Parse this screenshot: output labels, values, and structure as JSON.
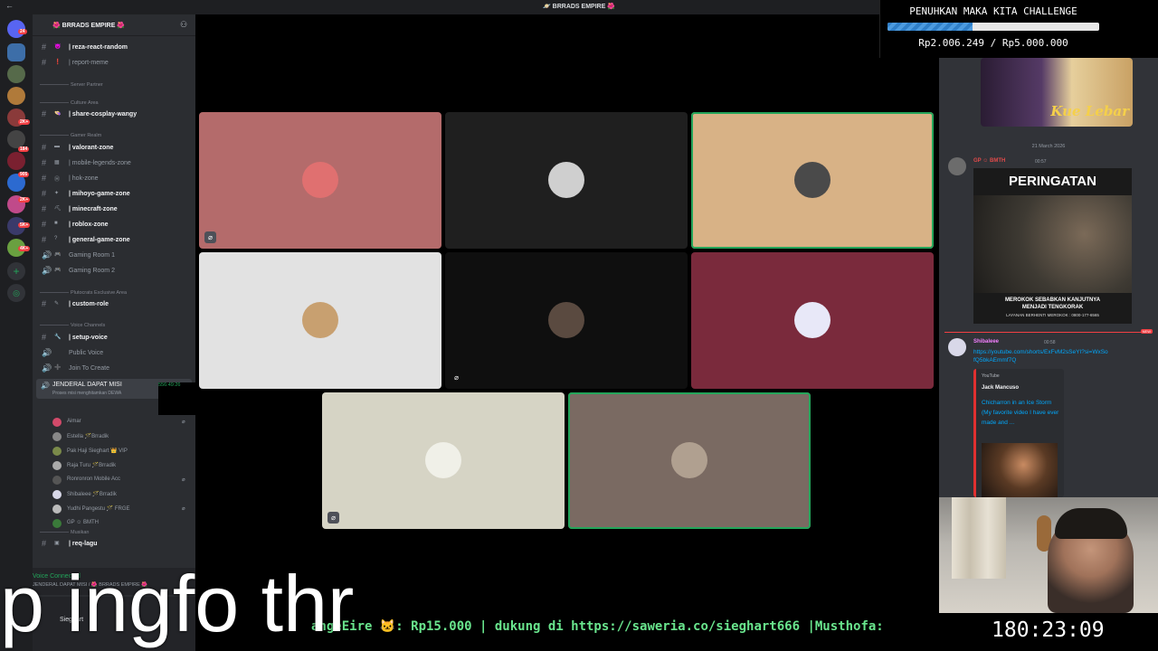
{
  "window": {
    "title": "🪐 BRRADS EMPIRE 🌺"
  },
  "server": {
    "name": "🌺 BRRADS EMPIRE 🌺"
  },
  "rail_badges": [
    "24",
    "2K+",
    "184",
    "905",
    "2K+",
    "5K+",
    "4K+"
  ],
  "channels": [
    {
      "label": "| reza-react-random",
      "emoji": "😈",
      "bright": true
    },
    {
      "label": "| report-meme",
      "emoji": "❗",
      "bright": false
    },
    {
      "label": "| share-cosplay-wangy",
      "emoji": "👒",
      "bright": true
    },
    {
      "label": "| valorant-zone",
      "emoji": "▬",
      "bright": true
    },
    {
      "label": "| mobile-legends-zone",
      "emoji": "▦",
      "bright": false
    },
    {
      "label": "| hok-zone",
      "emoji": "Ⓗ",
      "bright": false
    },
    {
      "label": "| mihoyo-game-zone",
      "emoji": "✦",
      "bright": true
    },
    {
      "label": "| minecraft-zone",
      "emoji": "⛏",
      "bright": true
    },
    {
      "label": "| roblox-zone",
      "emoji": "■",
      "bright": true
    },
    {
      "label": "| general-game-zone",
      "emoji": "?",
      "bright": true
    },
    {
      "label": "Gaming Room 1",
      "emoji": "🎮",
      "bright": false,
      "voice": true
    },
    {
      "label": "Gaming Room 2",
      "emoji": "🎮",
      "bright": false,
      "voice": true
    },
    {
      "label": "| custom-role",
      "emoji": "✎",
      "bright": true
    },
    {
      "label": "| setup-voice",
      "emoji": "🔧",
      "bright": true
    },
    {
      "label": "Public Voice",
      "emoji": "",
      "bright": false,
      "voice": true
    },
    {
      "label": "Join To Create",
      "emoji": "➕",
      "bright": false,
      "voice": true
    },
    {
      "label": "| req-lagu",
      "emoji": "▣",
      "bright": true
    }
  ],
  "categories": [
    "Server Partner",
    "Culture Area",
    "Gamer Realm",
    "Plutocrats Exclusive Area",
    "Voice Channels",
    "Musikan"
  ],
  "active_voice": {
    "name": "JENDERAL DAPAT MISI",
    "subtitle": "Proses misi menghitamkan DEWA",
    "timer": "556:49:26"
  },
  "members": [
    "Aimar",
    "Estella 🪄Brradik",
    "Pak Haji Sieghart 👑 VIP",
    "Raja Turu 🪄Brradik",
    "Ronronron Mobile Acc",
    "Shibaleee 🪄Brradik",
    "Yudhi Pangestu 🪄 FRGE",
    "GP ☺ BMTH"
  ],
  "voice_status": {
    "state": "Voice Connected",
    "channel": "JENDERAL DAPAT MISI / 🌺 BRRADS EMPIRE 🌺"
  },
  "user": {
    "name": "Sieghart"
  },
  "tiles": [
    {
      "bg": "#b46b6b",
      "muted": true,
      "speaking": false
    },
    {
      "bg": "#1f1f1f",
      "muted": false,
      "speaking": false
    },
    {
      "bg": "#d8b286",
      "muted": false,
      "speaking": true
    },
    {
      "bg": "#e2e2e2",
      "muted": false,
      "speaking": false
    },
    {
      "bg": "#0f0f0f",
      "muted": true,
      "speaking": false
    },
    {
      "bg": "#7a2a3c",
      "muted": false,
      "speaking": false
    },
    {
      "bg": "#d6d4c5",
      "muted": true,
      "speaking": false
    },
    {
      "bg": "#7a6a62",
      "muted": false,
      "speaking": true
    }
  ],
  "chat": {
    "image_caption": "Kue Lebar",
    "date": "21 March 2026",
    "msg1": {
      "author": "GP ☺ BMTH",
      "time": "00:57"
    },
    "poster": {
      "title": "PERINGATAN",
      "line1": "MEROKOK SEBABKAN KANJUTNYA",
      "line2": "MENJADI TENGKORAK",
      "line3": "LAYANAN BERHENTI MEROKOK : 0800-177-6565"
    },
    "new_label": "NEW",
    "msg2": {
      "author": "Shibaleee",
      "time": "00:58",
      "link": "https://youtube.com/shorts/ExFvM2sSeYI?si=WxSofQ5bkAEmmf7Q"
    },
    "embed": {
      "provider": "YouTube",
      "author": "Jack Mancuso",
      "title": "Chicharron in an Ice Storm (My favorite video I have ever made and ..."
    }
  },
  "overlay": {
    "challenge_title": "PENUHKAN MAKA KITA CHALLENGE",
    "challenge_progress": 0.4,
    "challenge_amount": "Rp2.006.249 / Rp5.000.000",
    "marquee": "angeEire 🐱: Rp15.000 |  dukung di https://saweria.co/sieghart666 |Musthofa:",
    "timer": "180:23:09",
    "caption": "p ingfo thr"
  }
}
